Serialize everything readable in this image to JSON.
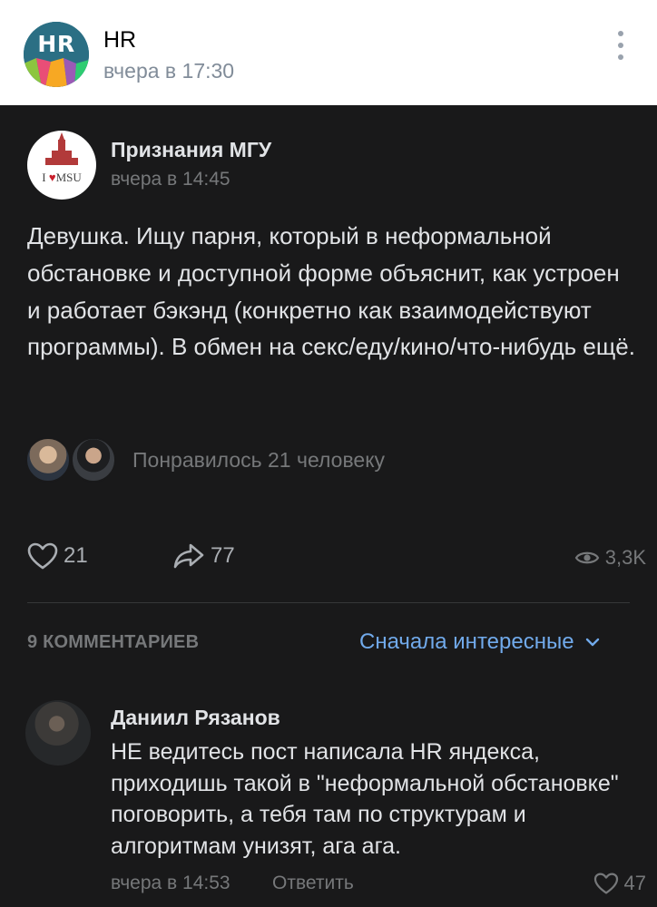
{
  "repost": {
    "author": "HR",
    "avatar_text": "HR",
    "time": "вчера в 17:30",
    "menu_icon": "more-vertical-icon"
  },
  "post": {
    "author": "Признания МГУ",
    "avatar_text": {
      "i": "I",
      "heart": "♥",
      "msu": "MSU"
    },
    "time": "вчера в 14:45",
    "text": "Девушка. Ищу парня, который в неформальной обстановке и доступной форме объяснит, как устроен и работает бэкэнд (конкретно как взаимодействуют программы). В обмен на секс/еду/кино/что-нибудь ещё.",
    "liked_by_label": "Понравилось 21 человеку",
    "likes": "21",
    "shares": "77",
    "views": "3,3K"
  },
  "comments": {
    "count_label": "9 КОММЕНТАРИЕВ",
    "sort_label": "Сначала интересные",
    "items": [
      {
        "author": "Даниил Рязанов",
        "text": "НЕ ведитесь пост написала HR яндекса, приходишь такой в \"неформальной обстановке\" поговорить, а тебя там по структурам и алгоритмам унизят, ага ага.",
        "time": "вчера в 14:53",
        "reply_label": "Ответить",
        "likes": "47"
      }
    ]
  },
  "colors": {
    "dark_bg": "#19191a",
    "text_primary": "#e1e3e6",
    "text_secondary": "#76787a",
    "accent": "#71aaeb"
  }
}
